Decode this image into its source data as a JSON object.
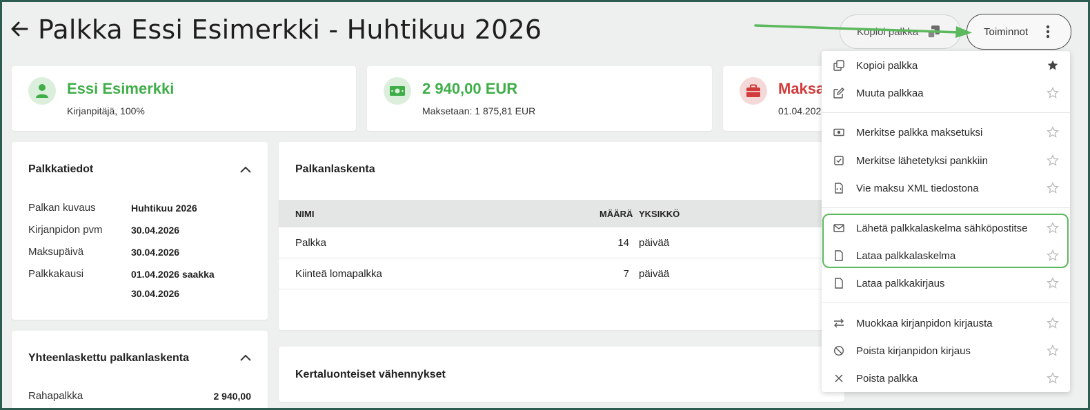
{
  "header": {
    "title": "Palkka Essi Esimerkki - Huhtikuu 2026",
    "copy_button": "Kopioi palkka",
    "actions_button": "Toiminnot"
  },
  "summary": [
    {
      "title": "Essi Esimerkki",
      "subtitle": "Kirjanpitäjä, 100%",
      "color": "#3fae49",
      "icon": "person-icon"
    },
    {
      "title": "2 940,00 EUR",
      "subtitle": "Maksetaan: 1 875,81 EUR",
      "color": "#3fae49",
      "icon": "money-icon"
    },
    {
      "title": "Maksa",
      "subtitle": "01.04.202",
      "color": "#d23b3b",
      "icon": "briefcase-icon"
    }
  ],
  "palkkatiedot": {
    "title": "Palkkatiedot",
    "rows": [
      {
        "label": "Palkan kuvaus",
        "value": "Huhtikuu 2026"
      },
      {
        "label": "Kirjanpidon pvm",
        "value": "30.04.2026"
      },
      {
        "label": "Maksupäivä",
        "value": "30.04.2026"
      },
      {
        "label": "Palkkakausi",
        "value": "01.04.2026 saakka",
        "value2": "30.04.2026"
      }
    ]
  },
  "yhteenlaskettu": {
    "title": "Yhteenlaskettu palkanlaskenta",
    "rows": [
      {
        "label": "Rahapalkka",
        "value": "2 940,00"
      }
    ]
  },
  "palkanlaskenta": {
    "title": "Palkanlaskenta",
    "columns": [
      "NIMI",
      "MÄÄRÄ",
      "YKSIKKÖ"
    ],
    "rows": [
      {
        "name": "Palkka",
        "amount": "14",
        "unit": "päivää"
      },
      {
        "name": "Kiinteä lomapalkka",
        "amount": "7",
        "unit": "päivää"
      }
    ]
  },
  "vahennykset": {
    "title": "Kertaluonteiset vähennykset"
  },
  "menu": {
    "items": [
      {
        "label": "Kopioi palkka",
        "icon": "copy-icon",
        "starred": true
      },
      {
        "label": "Muuta palkkaa",
        "icon": "edit-icon",
        "starred": false
      },
      {
        "label": "Merkitse palkka maksetuksi",
        "icon": "cash-icon",
        "starred": false
      },
      {
        "label": "Merkitse lähetetyksi pankkiin",
        "icon": "checkbox-icon",
        "starred": false
      },
      {
        "label": "Vie maksu XML tiedostona",
        "icon": "xml-file-icon",
        "starred": false
      },
      {
        "label": "Lähetä palkkalaskelma sähköpostitse",
        "icon": "mail-icon",
        "starred": false
      },
      {
        "label": "Lataa palkkalaskelma",
        "icon": "file-icon",
        "starred": false
      },
      {
        "label": "Lataa palkkakirjaus",
        "icon": "file-icon",
        "starred": false
      },
      {
        "label": "Muokkaa kirjanpidon kirjausta",
        "icon": "swap-icon",
        "starred": false
      },
      {
        "label": "Poista kirjanpidon kirjaus",
        "icon": "ban-icon",
        "starred": false
      },
      {
        "label": "Poista palkka",
        "icon": "close-icon",
        "starred": false
      }
    ]
  },
  "colors": {
    "accent_green": "#3fae49",
    "danger_red": "#d23b3b",
    "annotation_green": "#5cb85c"
  }
}
